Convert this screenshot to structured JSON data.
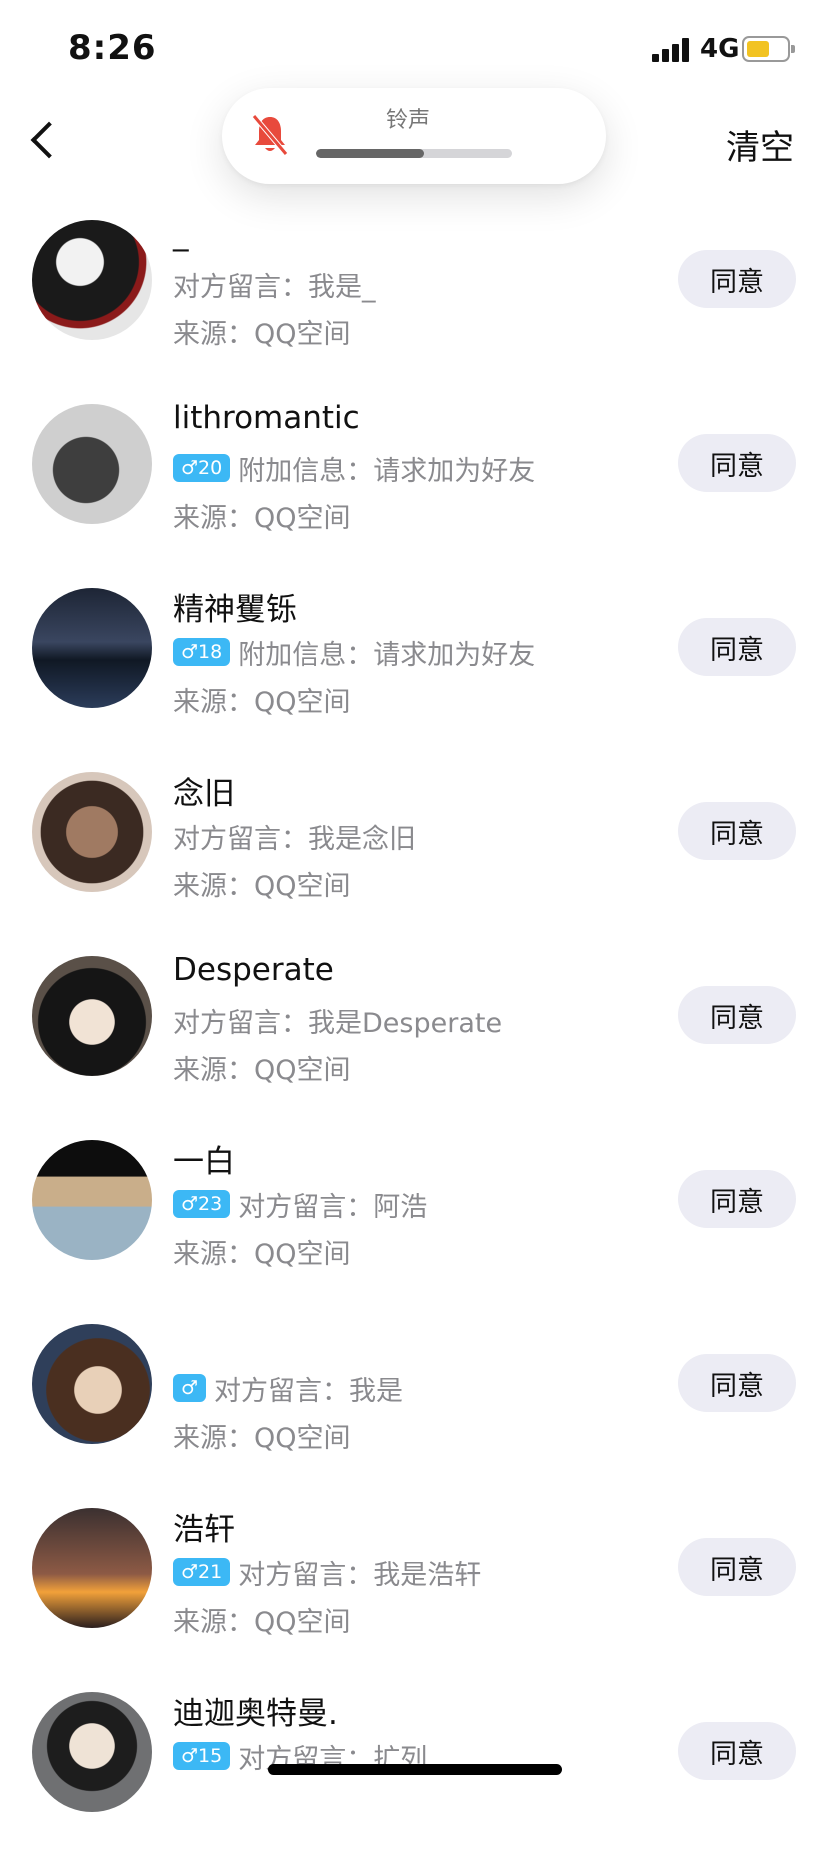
{
  "status_bar": {
    "time": "8:26",
    "network": "4G",
    "battery_color": "#f2c322"
  },
  "nav": {
    "clear_label": "清空"
  },
  "ringer": {
    "label": "铃声",
    "volume_fraction": 0.55,
    "muted": true,
    "mute_icon_color": "#e84a3c"
  },
  "agree_label": "同意",
  "badge_color": "#3cb8f5",
  "requests": [
    {
      "name": "_",
      "badge": "",
      "message": "对方留言：我是_",
      "source": "来源：QQ空间"
    },
    {
      "name": "lithromantic",
      "badge": "♂20",
      "message": "附加信息：请求加为好友",
      "source": "来源：QQ空间"
    },
    {
      "name": "精神矍铄",
      "badge": "♂18",
      "message": "附加信息：请求加为好友",
      "source": "来源：QQ空间"
    },
    {
      "name": "念旧",
      "badge": "",
      "message": "对方留言：我是念旧",
      "source": "来源：QQ空间"
    },
    {
      "name": "Desperate",
      "badge": "",
      "message": "对方留言：我是Desperate",
      "source": "来源：QQ空间"
    },
    {
      "name": "一白",
      "badge": "♂23",
      "message": "对方留言：阿浩",
      "source": "来源：QQ空间"
    },
    {
      "name": "",
      "badge": "♂",
      "message": "对方留言：我是",
      "source": "来源：QQ空间"
    },
    {
      "name": "浩轩",
      "badge": "♂21",
      "message": "对方留言：我是浩轩",
      "source": "来源：QQ空间"
    },
    {
      "name": "迪迦奥特曼.",
      "badge": "♂15",
      "message": "对方留言：扩列",
      "source": ""
    }
  ]
}
